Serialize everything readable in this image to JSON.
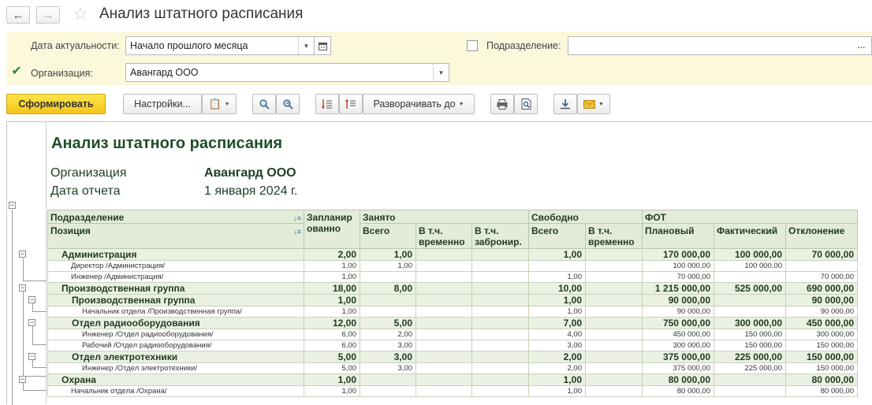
{
  "window": {
    "title": "Анализ штатного расписания"
  },
  "filters": {
    "date_label": "Дата актуальности:",
    "date_value": "Начало прошлого месяца",
    "org_label": "Организация:",
    "org_value": "Авангард ООО",
    "org_checked": true,
    "dept_label": "Подразделение:",
    "dept_value": "",
    "dept_checked": false
  },
  "toolbar": {
    "generate": "Сформировать",
    "settings": "Настройки...",
    "expand": "Разворачивать до"
  },
  "report": {
    "title": "Анализ штатного расписания",
    "org_label": "Организация",
    "org_value": "Авангард ООО",
    "date_label": "Дата отчета",
    "date_value": "1 января 2024 г."
  },
  "table": {
    "headers": {
      "dept": "Подразделение",
      "position": "Позиция",
      "planned": "Запланир ованно",
      "occupied": "Занято",
      "occ_total": "Всего",
      "occ_temp": "В т.ч. временно",
      "occ_reserved": "В т.ч. забронир.",
      "free": "Свободно",
      "free_total": "Всего",
      "free_temp": "В т.ч. временно",
      "fot": "ФОТ",
      "fot_plan": "Плановый",
      "fot_fact": "Фактический",
      "fot_dev": "Отклонение"
    },
    "rows": [
      {
        "level": 1,
        "name": "Администрация",
        "planned": "2,00",
        "occ_total": "1,00",
        "occ_temp": "",
        "occ_reserved": "",
        "free_total": "1,00",
        "free_temp": "",
        "fot_plan": "170 000,00",
        "fot_fact": "100 000,00",
        "fot_dev": "70 000,00"
      },
      {
        "level": 3,
        "name": "Директор /Администрация/",
        "planned": "1,00",
        "occ_total": "1,00",
        "occ_temp": "",
        "occ_reserved": "",
        "free_total": "",
        "free_temp": "",
        "fot_plan": "100 000,00",
        "fot_fact": "100 000,00",
        "fot_dev": ""
      },
      {
        "level": 3,
        "name": "Инженер /Администрация/",
        "planned": "1,00",
        "occ_total": "",
        "occ_temp": "",
        "occ_reserved": "",
        "free_total": "1,00",
        "free_temp": "",
        "fot_plan": "70 000,00",
        "fot_fact": "",
        "fot_dev": "70 000,00"
      },
      {
        "level": 1,
        "name": "Производственная группа",
        "planned": "18,00",
        "occ_total": "8,00",
        "occ_temp": "",
        "occ_reserved": "",
        "free_total": "10,00",
        "free_temp": "",
        "fot_plan": "1 215 000,00",
        "fot_fact": "525 000,00",
        "fot_dev": "690 000,00"
      },
      {
        "level": 2,
        "name": "Производственная группа",
        "planned": "1,00",
        "occ_total": "",
        "occ_temp": "",
        "occ_reserved": "",
        "free_total": "1,00",
        "free_temp": "",
        "fot_plan": "90 000,00",
        "fot_fact": "",
        "fot_dev": "90 000,00"
      },
      {
        "level": 4,
        "name": "Начальник отдела /Производственная группа/",
        "planned": "1,00",
        "occ_total": "",
        "occ_temp": "",
        "occ_reserved": "",
        "free_total": "1,00",
        "free_temp": "",
        "fot_plan": "90 000,00",
        "fot_fact": "",
        "fot_dev": "90 000,00"
      },
      {
        "level": 2,
        "name": "Отдел радиооборудования",
        "planned": "12,00",
        "occ_total": "5,00",
        "occ_temp": "",
        "occ_reserved": "",
        "free_total": "7,00",
        "free_temp": "",
        "fot_plan": "750 000,00",
        "fot_fact": "300 000,00",
        "fot_dev": "450 000,00"
      },
      {
        "level": 4,
        "name": "Инженер /Отдел радиооборудования/",
        "planned": "6,00",
        "occ_total": "2,00",
        "occ_temp": "",
        "occ_reserved": "",
        "free_total": "4,00",
        "free_temp": "",
        "fot_plan": "450 000,00",
        "fot_fact": "150 000,00",
        "fot_dev": "300 000,00"
      },
      {
        "level": 4,
        "name": "Рабочий /Отдел радиооборудования/",
        "planned": "6,00",
        "occ_total": "3,00",
        "occ_temp": "",
        "occ_reserved": "",
        "free_total": "3,00",
        "free_temp": "",
        "fot_plan": "300 000,00",
        "fot_fact": "150 000,00",
        "fot_dev": "150 000,00"
      },
      {
        "level": 2,
        "name": "Отдел электротехники",
        "planned": "5,00",
        "occ_total": "3,00",
        "occ_temp": "",
        "occ_reserved": "",
        "free_total": "2,00",
        "free_temp": "",
        "fot_plan": "375 000,00",
        "fot_fact": "225 000,00",
        "fot_dev": "150 000,00"
      },
      {
        "level": 4,
        "name": "Инженер /Отдел электротехники/",
        "planned": "5,00",
        "occ_total": "3,00",
        "occ_temp": "",
        "occ_reserved": "",
        "free_total": "2,00",
        "free_temp": "",
        "fot_plan": "375 000,00",
        "fot_fact": "225 000,00",
        "fot_dev": "150 000,00"
      },
      {
        "level": 1,
        "name": "Охрана",
        "planned": "1,00",
        "occ_total": "",
        "occ_temp": "",
        "occ_reserved": "",
        "free_total": "1,00",
        "free_temp": "",
        "fot_plan": "80 000,00",
        "fot_fact": "",
        "fot_dev": "80 000,00"
      },
      {
        "level": 3,
        "name": "Начальник отдела /Охрана/",
        "planned": "1,00",
        "occ_total": "",
        "occ_temp": "",
        "occ_reserved": "",
        "free_total": "1,00",
        "free_temp": "",
        "fot_plan": "80 000,00",
        "fot_fact": "",
        "fot_dev": "80 000,00"
      }
    ]
  }
}
